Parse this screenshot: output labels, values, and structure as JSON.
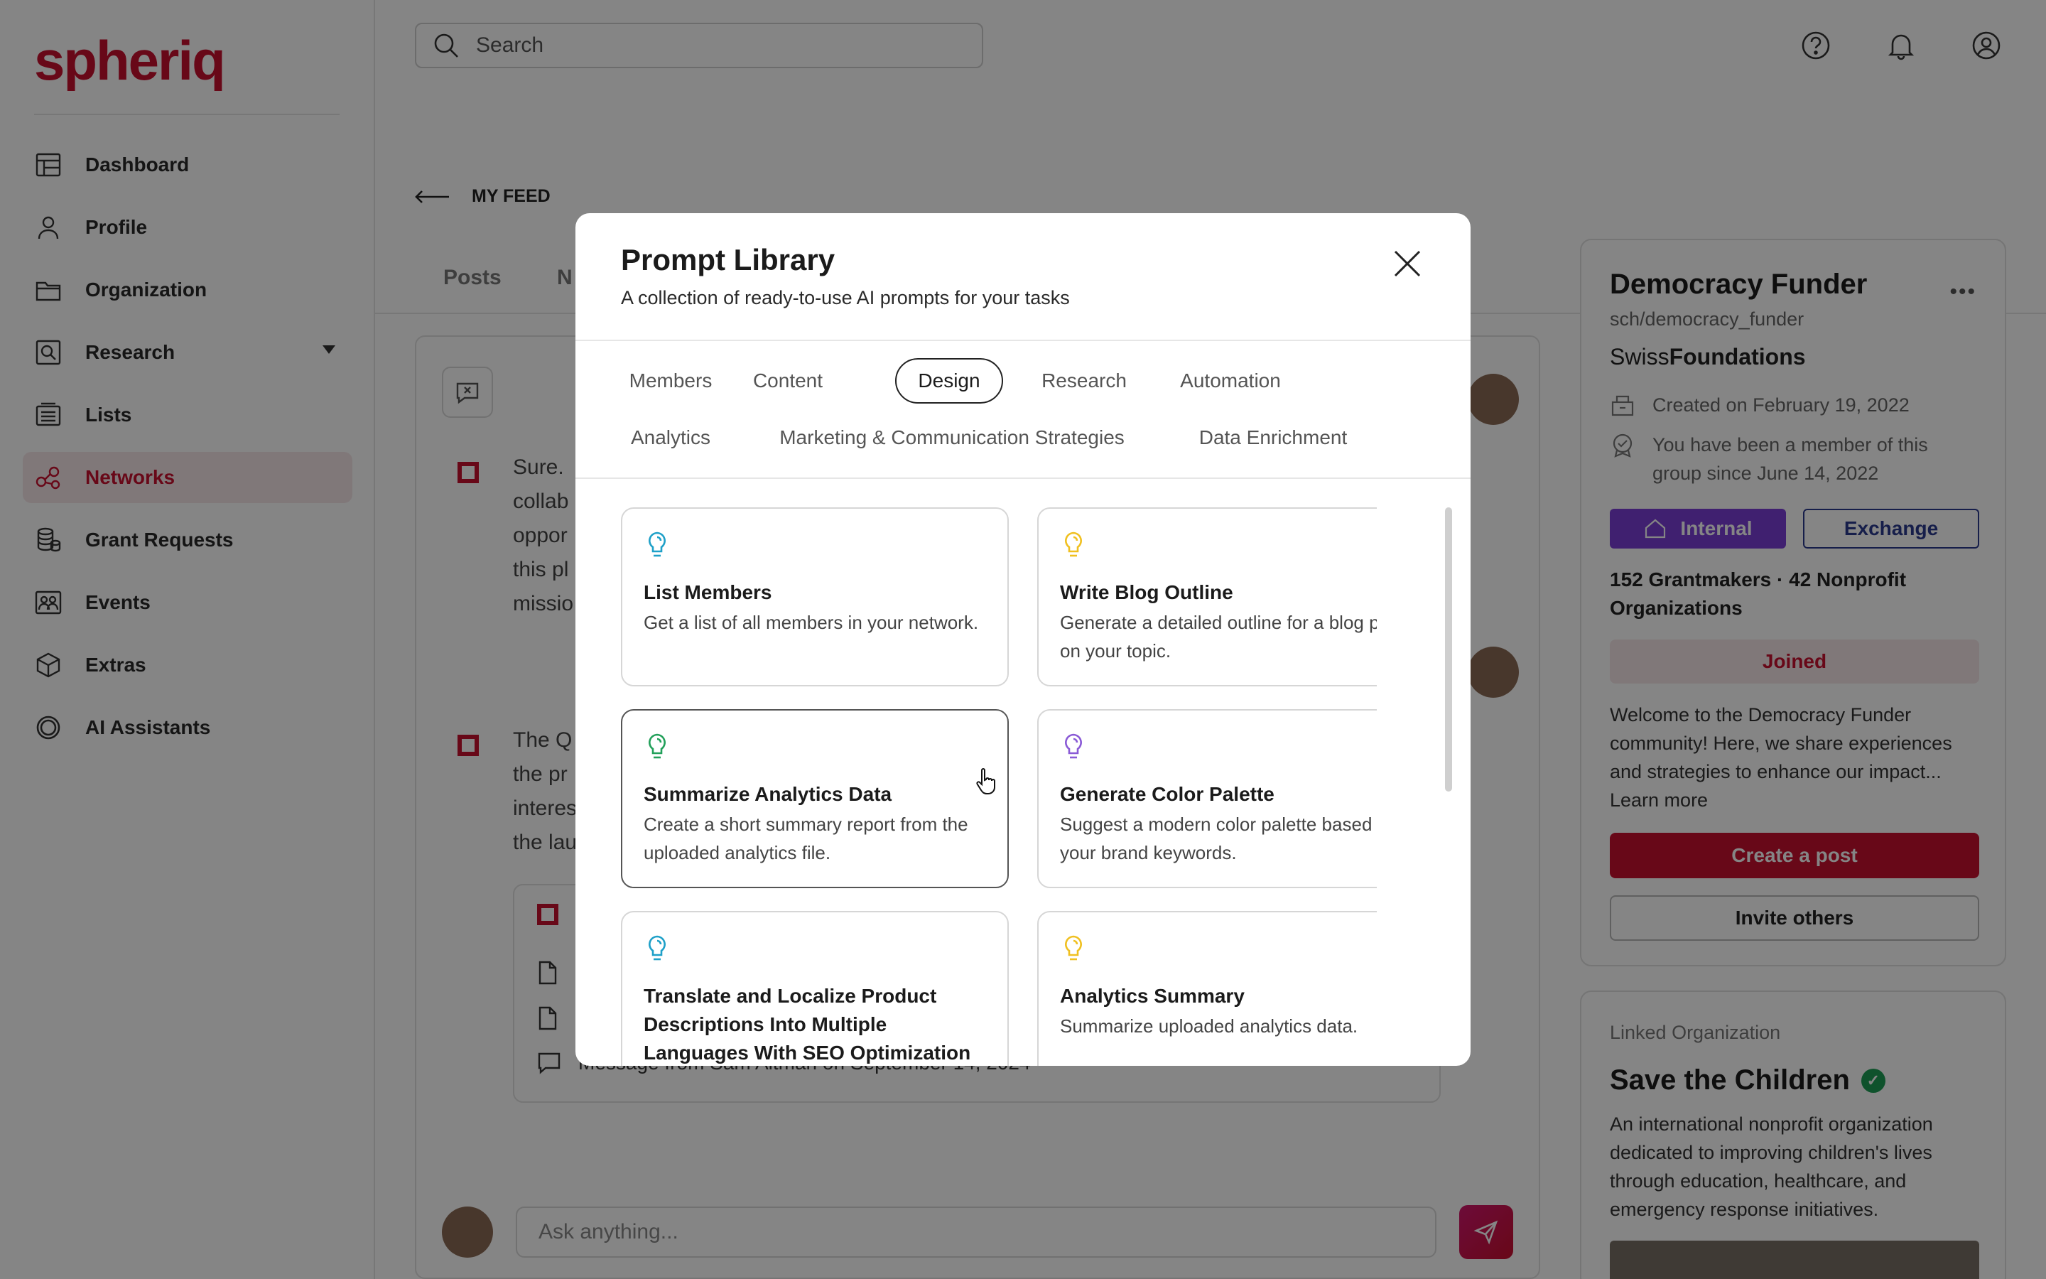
{
  "app": {
    "logo": "spheriq"
  },
  "sidebar": {
    "items": [
      {
        "label": "Dashboard",
        "icon": "dashboard-icon"
      },
      {
        "label": "Profile",
        "icon": "user-icon"
      },
      {
        "label": "Organization",
        "icon": "folder-icon"
      },
      {
        "label": "Research",
        "icon": "search-doc-icon",
        "has_caret": true
      },
      {
        "label": "Lists",
        "icon": "list-icon"
      },
      {
        "label": "Networks",
        "icon": "network-icon",
        "active": true
      },
      {
        "label": "Grant Requests",
        "icon": "coins-icon"
      },
      {
        "label": "Events",
        "icon": "people-icon"
      },
      {
        "label": "Extras",
        "icon": "box-icon"
      },
      {
        "label": "AI Assistants",
        "icon": "ai-icon"
      }
    ]
  },
  "header": {
    "search_placeholder": "Search",
    "icons": [
      "help-icon",
      "bell-icon",
      "account-icon"
    ]
  },
  "feed": {
    "back_label": "MY FEED",
    "tabs": [
      "Posts",
      "N"
    ],
    "messages": [
      {
        "lines": [
          "Sure.",
          "collab",
          "oppor",
          "this pl",
          "missio"
        ]
      },
      {
        "lines": [
          "The Q",
          "the pr",
          "interes",
          "the lau"
        ]
      }
    ],
    "attachment_comment": "Message from Sam Altman on September 14, 2024",
    "ask_placeholder": "Ask anything..."
  },
  "group": {
    "name": "Democracy Funder",
    "handle": "sch/democracy_funder",
    "org_prefix": "Swiss",
    "org_bold": "Foundations",
    "created": "Created on February 19, 2022",
    "member_since": "You have been a member of this group since June 14, 2022",
    "badge_internal": "Internal",
    "badge_exchange": "Exchange",
    "stats": "152 Grantmakers · 42 Nonprofit Organizations",
    "joined_label": "Joined",
    "welcome": "Welcome to the Democracy Funder community! Here, we share experiences and strategies to enhance our impact... Learn more",
    "create_label": "Create a post",
    "invite_label": "Invite others"
  },
  "linked": {
    "label": "Linked Organization",
    "name": "Save the Children",
    "description": "An international nonprofit organization dedicated to improving children's lives through education, healthcare, and emergency response initiatives."
  },
  "modal": {
    "title": "Prompt Library",
    "subtitle": "A collection of ready-to-use AI prompts for your tasks",
    "tabs_row1": [
      "Members",
      "Content",
      "Design",
      "Research",
      "Automation"
    ],
    "tabs_row2": [
      "Analytics",
      "Marketing & Communication Strategies",
      "Data Enrichment"
    ],
    "active_tab": "Design",
    "cards": [
      {
        "title": "List Members",
        "description": "Get a list of all members in your network.",
        "bulb_color": "#1ea0c8"
      },
      {
        "title": "Write Blog Outline",
        "description": "Generate a detailed outline for a blog post on your topic.",
        "bulb_color": "#f0c020"
      },
      {
        "title": "Summarize Analytics Data",
        "description": "Create a short summary report from the uploaded analytics file.",
        "bulb_color": "#22a05a"
      },
      {
        "title": "Generate Color Palette",
        "description": "Suggest a modern color palette based on your brand keywords.",
        "bulb_color": "#8a5ad6"
      },
      {
        "title": "Translate and Localize Product Descriptions Into Multiple Languages With SEO Optimization",
        "description": "",
        "bulb_color": "#1ea0c8"
      },
      {
        "title": "Analytics Summary",
        "description": "Summarize uploaded analytics data.",
        "bulb_color": "#f0c020"
      }
    ]
  },
  "colors": {
    "brand": "#c8102e",
    "internal": "#7b3fd6",
    "exchange": "#2b3a8f"
  }
}
